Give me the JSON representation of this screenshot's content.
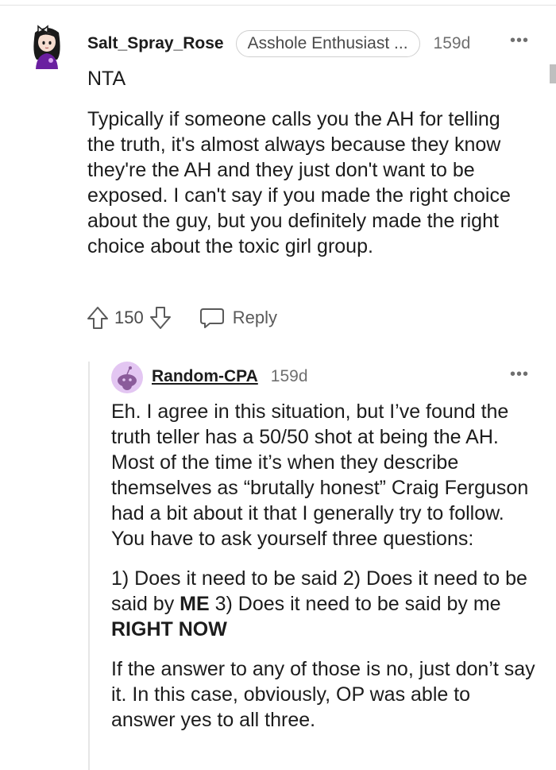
{
  "parent_comment": {
    "username": "Salt_Spray_Rose",
    "flair": "Asshole Enthusiast ...",
    "timestamp": "159d",
    "more_label": "•••",
    "verdict": "NTA",
    "body": "Typically if someone calls you the AH for telling the truth, it's almost always because they know they're the AH and they just don't want to be exposed. I can't say if you made the right choice about the guy, but you definitely made the right choice about the toxic girl group.",
    "vote_count": "150",
    "reply_label": "Reply"
  },
  "reply_comment": {
    "username": "Random-CPA",
    "timestamp": "159d",
    "more_label": "•••",
    "paragraph_1": "Eh. I agree in this situation, but I’ve found the truth teller has a 50/50 shot at being the AH. Most of the time it’s when they describe themselves as “brutally honest” Craig Ferguson had a bit about it that I generally try to follow. You have to ask yourself three questions:",
    "p2_a": "1) Does it need to be said 2) Does it need to be said by ",
    "p2_b": "ME",
    "p2_c": " 3) Does it need to be said by me ",
    "p2_d": "RIGHT NOW",
    "paragraph_3": "If the answer to any of those is no, just don’t say it. In this case, obviously, OP was able to answer yes to all three."
  },
  "icons": {
    "parent_avatar": "cartoon-girl-avatar-icon",
    "reply_avatar": "snoo-avatar-icon",
    "upvote": "arrow-up-icon",
    "downvote": "arrow-down-icon",
    "reply": "speech-bubble-icon",
    "more": "ellipsis-icon"
  }
}
